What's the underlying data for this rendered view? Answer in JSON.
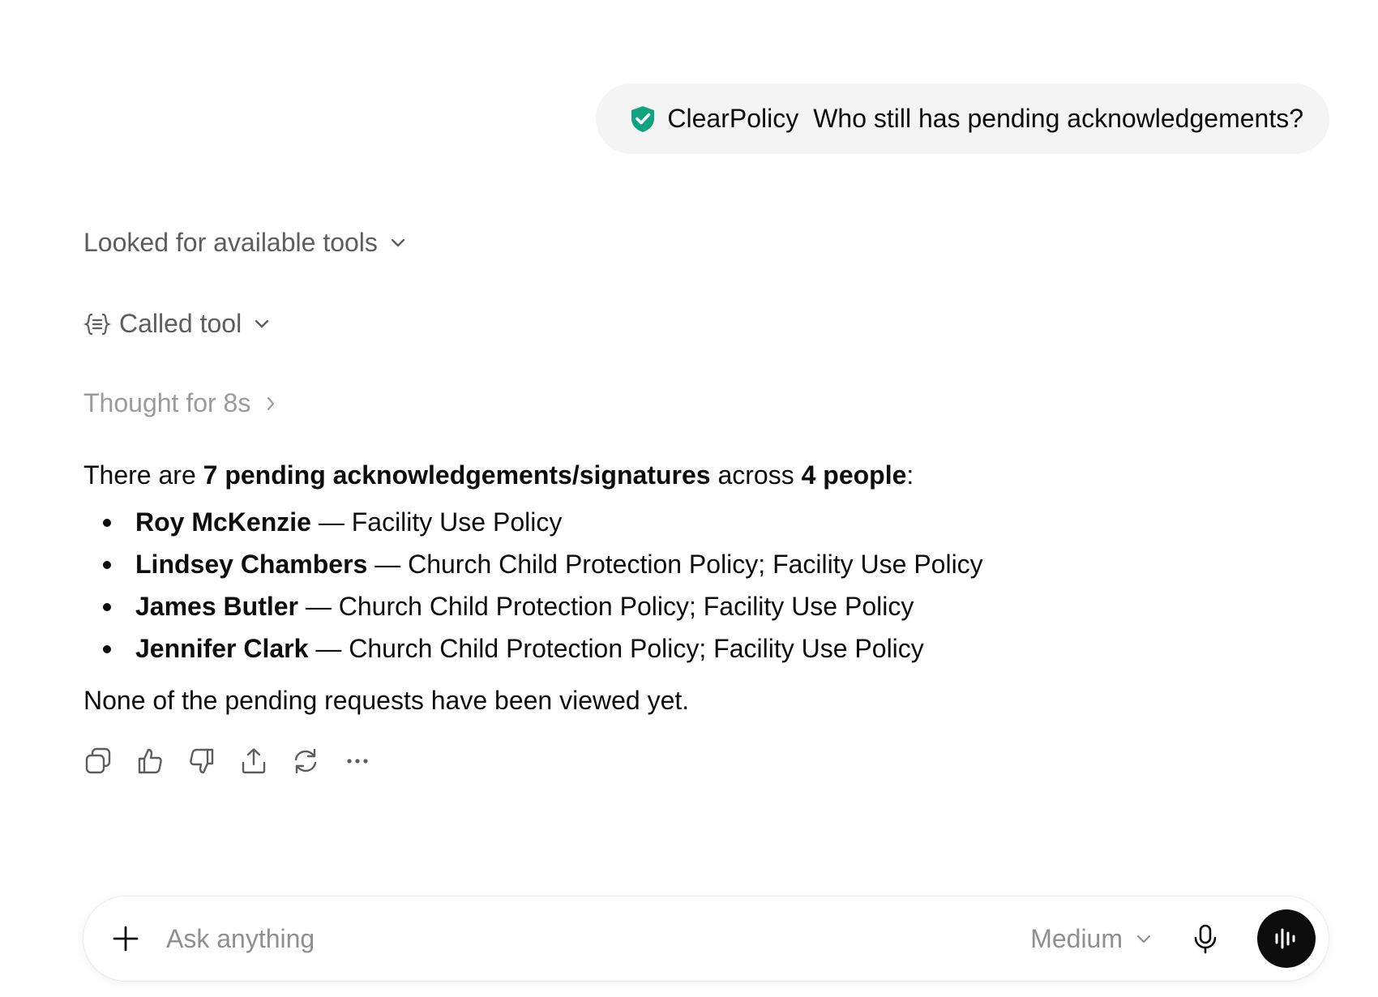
{
  "user_message": {
    "app_name": "ClearPolicy",
    "text": "Who still has pending acknowledgements?",
    "shield_color": "#10a37f"
  },
  "steps": {
    "looked_label": "Looked for available tools",
    "called_label": "Called tool",
    "thought_label": "Thought for 8s"
  },
  "answer": {
    "intro_pre": "There are ",
    "intro_bold1": "7 pending acknowledgements/signatures",
    "intro_mid": " across ",
    "intro_bold2": "4 people",
    "intro_post": ":",
    "items": [
      {
        "name": "Roy McKenzie",
        "detail": " — Facility Use Policy"
      },
      {
        "name": "Lindsey Chambers",
        "detail": " — Church Child Protection Policy; Facility Use Policy"
      },
      {
        "name": "James Butler",
        "detail": " — Church Child Protection Policy; Facility Use Policy"
      },
      {
        "name": "Jennifer Clark",
        "detail": " — Church Child Protection Policy; Facility Use Policy"
      }
    ],
    "closing": "None of the pending requests have been viewed yet."
  },
  "actions": [
    "copy-icon",
    "thumbs-up-icon",
    "thumbs-down-icon",
    "share-icon",
    "regenerate-icon",
    "more-icon"
  ],
  "composer": {
    "placeholder": "Ask anything",
    "model_label": "Medium"
  }
}
